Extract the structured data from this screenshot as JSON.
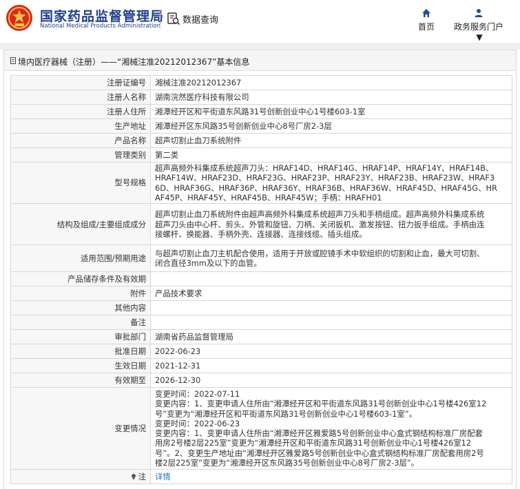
{
  "header": {
    "site_name_cn": "国家药品监督管理局",
    "site_name_en": "National Medical Products Administration",
    "emblem_icon": "national-emblem-icon",
    "db_query_label": "数据查询",
    "nav": [
      {
        "label": "首页",
        "icon": "home-icon"
      },
      {
        "label": "政务服务门户",
        "icon": "user-icon"
      }
    ],
    "brand_color": "#1f3f8c"
  },
  "title_bar": {
    "text": "境内医疗器械（注册）——“湘械注准20212012367”基本信息"
  },
  "rows": [
    {
      "label": "注册证编号",
      "value": "湘械注准20212012367"
    },
    {
      "label": "注册人名称",
      "value": "湖南浣然医疗科技有限公司"
    },
    {
      "label": "注册人住所",
      "value": "湘潭经开区和平街道东风路31号创新创业中心1号楼603-1室"
    },
    {
      "label": "生产地址",
      "value": "湘潭经开区东风路35号创新创业中心8号厂房2-3层"
    },
    {
      "label": "产品名称",
      "value": "超声切割止血刀系统附件"
    },
    {
      "label": "管理类别",
      "value": "第二类"
    },
    {
      "label": "型号规格",
      "value": "超声高频外科集成系统超声刀头：HRAF14D、HRAF14G、HRAF14P、HRAF14Y、HRAF14B、\nHRAF14W、HRAF23D、HRAF23G、HRAF23P、HRAF23Y、HRAF23B、HRAF23W、HRAF3\n6D、HRAF36G、HRAF36P、HRAF36Y、HRAF36B、HRAF36W、HRAF45D、HRAF45G、HR\nAF45P、HRAF45Y、HRAF45B、HRAF45W；手柄：HRAFH01"
    },
    {
      "label": "结构及组成/主要组成成分",
      "value": "超声切割止血刀系统附件由超声高频外科集成系统超声刀头和手柄组成。超声高频外科集成系统\n超声刀头由中心杆、剪头、外管和旋钮、刀柄、关闭扳机、激发按钮、扭力扳手组成。手柄由连\n接螺杆、换能器、手柄外壳、连接器、连接线缆、插头组成。"
    },
    {
      "label": "适用范围/预期用途",
      "value": "与超声切割止血刀主机配合使用，适用于开放或腔镜手术中软组织的切割和止血，最大可切割、\n闭合直径3mm及以下的血管。"
    },
    {
      "label": "产品储存条件及有效期",
      "value": ""
    },
    {
      "label": "附件",
      "value": "产品技术要求"
    },
    {
      "label": "其他内容",
      "value": ""
    },
    {
      "label": "备注",
      "value": ""
    },
    {
      "label": "审批部门",
      "value": "湖南省药品监督管理局"
    },
    {
      "label": "批准日期",
      "value": "2022-06-23"
    },
    {
      "label": "生效日期",
      "value": "2021-12-31"
    },
    {
      "label": "有效期至",
      "value": "2026-12-30"
    },
    {
      "label": "变更情况",
      "value": "变更时间：2022-07-11\n变更内容：1、变更申请人住所由“湘潭经开区和平街道东风路31号创新创业中心1号楼426室12\n号”变更为“湘潭经开区和平街道东风路31号创新创业中心1号楼603-1室”。\n变更时间：2022-06-23\n变更内容：1、变更申请人住所由“湘潭经开区雅爱路5号创新创业中心盒式钢结构标准厂房配套\n用房2号楼2层225室”变更为“湘潭经开区和平街道东风路31号创新创业中心1号楼426室12\n号”。2、变更生产地址由“湘潭经开区雅爱路5号创新创业中心盒式钢结构标准厂房配套用房2号\n楼2层225室”变更为“湘潭经开区东风路35号创新创业中心8号厂房2-3层”。"
    }
  ],
  "note_row": {
    "label": "注",
    "icon": "lightbulb-icon",
    "link": "详情"
  }
}
